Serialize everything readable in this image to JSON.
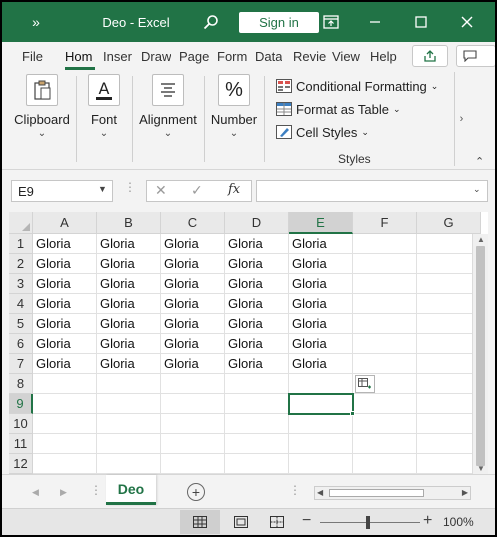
{
  "titlebar": {
    "qat_symbol": "»",
    "title": "Deo  -  Excel",
    "signin": "Sign in"
  },
  "tabs": [
    "File",
    "Hom",
    "Inser",
    "Draw",
    "Page",
    "Form",
    "Data",
    "Revie",
    "View",
    "Help"
  ],
  "active_tab": "Hom",
  "ribbon": {
    "clipboard": "Clipboard",
    "font": "Font",
    "alignment": "Alignment",
    "number": "Number",
    "number_symbol": "%",
    "conditional_formatting": "Conditional Formatting",
    "format_as_table": "Format as Table",
    "cell_styles": "Cell Styles",
    "styles_group": "Styles",
    "font_letter": "A"
  },
  "formula_bar": {
    "name_box": "E9",
    "fx": "fx",
    "content": ""
  },
  "grid": {
    "columns": [
      "A",
      "B",
      "C",
      "D",
      "E",
      "F",
      "G"
    ],
    "rows": [
      "1",
      "2",
      "3",
      "4",
      "5",
      "6",
      "7",
      "8",
      "9",
      "10",
      "11",
      "12"
    ],
    "cells": [
      [
        "Gloria",
        "Gloria",
        "Gloria",
        "Gloria",
        "Gloria",
        "",
        ""
      ],
      [
        "Gloria",
        "Gloria",
        "Gloria",
        "Gloria",
        "Gloria",
        "",
        ""
      ],
      [
        "Gloria",
        "Gloria",
        "Gloria",
        "Gloria",
        "Gloria",
        "",
        ""
      ],
      [
        "Gloria",
        "Gloria",
        "Gloria",
        "Gloria",
        "Gloria",
        "",
        ""
      ],
      [
        "Gloria",
        "Gloria",
        "Gloria",
        "Gloria",
        "Gloria",
        "",
        ""
      ],
      [
        "Gloria",
        "Gloria",
        "Gloria",
        "Gloria",
        "Gloria",
        "",
        ""
      ],
      [
        "Gloria",
        "Gloria",
        "Gloria",
        "Gloria",
        "Gloria",
        "",
        ""
      ],
      [
        "",
        "",
        "",
        "",
        "",
        "",
        ""
      ],
      [
        "",
        "",
        "",
        "",
        "",
        "",
        ""
      ],
      [
        "",
        "",
        "",
        "",
        "",
        "",
        ""
      ],
      [
        "",
        "",
        "",
        "",
        "",
        "",
        ""
      ],
      [
        "",
        "",
        "",
        "",
        "",
        "",
        ""
      ]
    ],
    "active_column": "E",
    "active_row": "9"
  },
  "sheets": {
    "active": "Deo",
    "add_symbol": "+"
  },
  "status": {
    "zoom": "100%",
    "minus": "−",
    "plus": "+"
  },
  "colors": {
    "accent": "#217346"
  }
}
